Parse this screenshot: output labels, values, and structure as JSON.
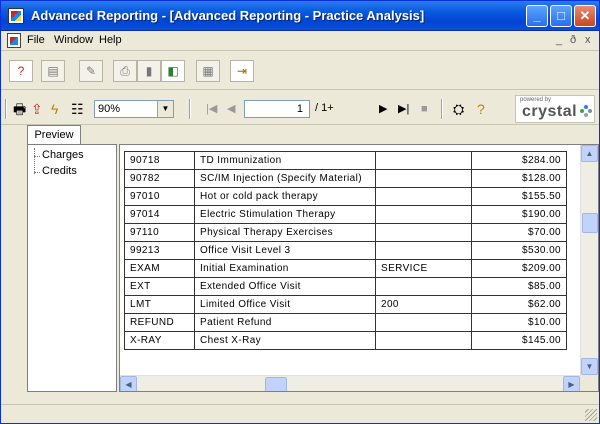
{
  "window": {
    "title": "Advanced Reporting - [Advanced Reporting - Practice Analysis]",
    "controls": [
      "minimize-icon",
      "maximize-icon",
      "close-icon"
    ]
  },
  "menubar": {
    "items": [
      "File",
      "Window",
      "Help"
    ],
    "mdi_controls": {
      "minimize": "_",
      "restore": "ð",
      "close": "x"
    }
  },
  "toolbar_top": {
    "icons": [
      "help-pointer-icon",
      "open-icon",
      "pen-icon",
      "print-setup-icon",
      "export-icon",
      "mail-icon",
      "grid-icon",
      "exit-door-icon"
    ]
  },
  "viewer_toolbar": {
    "zoom": "90%",
    "page_current": "1",
    "page_total": "/ 1+",
    "logo_small": "powered by",
    "logo_text": "crystal"
  },
  "tabs": {
    "preview": "Preview"
  },
  "tree": {
    "items": [
      "Charges",
      "Credits"
    ]
  },
  "report": {
    "rows": [
      [
        "90718",
        "TD Immunization",
        "",
        "$284.00"
      ],
      [
        "90782",
        "SC/IM Injection (Specify Material)",
        "",
        "$128.00"
      ],
      [
        "97010",
        "Hot or cold pack therapy",
        "",
        "$155.50"
      ],
      [
        "97014",
        "Electric Stimulation Therapy",
        "",
        "$190.00"
      ],
      [
        "97110",
        "Physical Therapy Exercises",
        "",
        "$70.00"
      ],
      [
        "99213",
        "Office Visit Level 3",
        "",
        "$530.00"
      ],
      [
        "EXAM",
        "Initial Examination",
        "SERVICE",
        "$209.00"
      ],
      [
        "EXT",
        "Extended Office Visit",
        "",
        "$85.00"
      ],
      [
        "LMT",
        "Limited Office Visit",
        "200",
        "$62.00"
      ],
      [
        "REFUND",
        "Patient Refund",
        "",
        "$10.00"
      ],
      [
        "X-RAY",
        "Chest X-Ray",
        "",
        "$145.00"
      ]
    ]
  },
  "colors": {
    "titlebar": "#0a5be0",
    "chrome": "#ece9d8",
    "report_background": "#808080"
  }
}
